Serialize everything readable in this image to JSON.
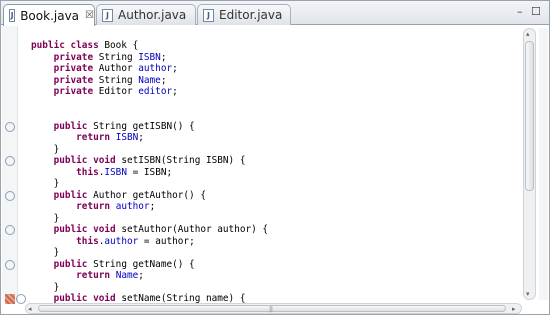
{
  "tabs": [
    {
      "label": "Book.java",
      "icon": "java-file-icon",
      "active": true,
      "close": "☒"
    },
    {
      "label": "Author.java",
      "icon": "java-file-icon",
      "active": false
    },
    {
      "label": "Editor.java",
      "icon": "java-file-icon",
      "active": false
    }
  ],
  "window_controls": {
    "minimize": "–",
    "maximize": "☐"
  },
  "editor": {
    "lines": [
      [
        {
          "t": "public class",
          "c": "kw"
        },
        {
          "t": " Book {"
        }
      ],
      [
        {
          "t": "    "
        },
        {
          "t": "private",
          "c": "kw"
        },
        {
          "t": " String "
        },
        {
          "t": "ISBN",
          "c": "fld"
        },
        {
          "t": ";"
        }
      ],
      [
        {
          "t": "    "
        },
        {
          "t": "private",
          "c": "kw"
        },
        {
          "t": " Author "
        },
        {
          "t": "author",
          "c": "fld"
        },
        {
          "t": ";"
        }
      ],
      [
        {
          "t": "    "
        },
        {
          "t": "private",
          "c": "kw"
        },
        {
          "t": " String "
        },
        {
          "t": "Name",
          "c": "fld"
        },
        {
          "t": ";"
        }
      ],
      [
        {
          "t": "    "
        },
        {
          "t": "private",
          "c": "kw"
        },
        {
          "t": " Editor "
        },
        {
          "t": "editor",
          "c": "fld"
        },
        {
          "t": ";"
        }
      ],
      [],
      [],
      [
        {
          "t": "    "
        },
        {
          "t": "public",
          "c": "kw"
        },
        {
          "t": " String getISBN() {"
        }
      ],
      [
        {
          "t": "        "
        },
        {
          "t": "return",
          "c": "kw"
        },
        {
          "t": " "
        },
        {
          "t": "ISBN",
          "c": "fld"
        },
        {
          "t": ";"
        }
      ],
      [
        {
          "t": "    }"
        }
      ],
      [
        {
          "t": "    "
        },
        {
          "t": "public void",
          "c": "kw"
        },
        {
          "t": " setISBN(String ISBN) {"
        }
      ],
      [
        {
          "t": "        "
        },
        {
          "t": "this",
          "c": "kw"
        },
        {
          "t": "."
        },
        {
          "t": "ISBN",
          "c": "fld"
        },
        {
          "t": " = ISBN;"
        }
      ],
      [
        {
          "t": "    }"
        }
      ],
      [
        {
          "t": "    "
        },
        {
          "t": "public",
          "c": "kw"
        },
        {
          "t": " Author getAuthor() {"
        }
      ],
      [
        {
          "t": "        "
        },
        {
          "t": "return",
          "c": "kw"
        },
        {
          "t": " "
        },
        {
          "t": "author",
          "c": "fld"
        },
        {
          "t": ";"
        }
      ],
      [
        {
          "t": "    }"
        }
      ],
      [
        {
          "t": "    "
        },
        {
          "t": "public void",
          "c": "kw"
        },
        {
          "t": " setAuthor(Author author) {"
        }
      ],
      [
        {
          "t": "        "
        },
        {
          "t": "this",
          "c": "kw"
        },
        {
          "t": "."
        },
        {
          "t": "author",
          "c": "fld"
        },
        {
          "t": " = author;"
        }
      ],
      [
        {
          "t": "    }"
        }
      ],
      [
        {
          "t": "    "
        },
        {
          "t": "public",
          "c": "kw"
        },
        {
          "t": " String getName() {"
        }
      ],
      [
        {
          "t": "        "
        },
        {
          "t": "return",
          "c": "kw"
        },
        {
          "t": " "
        },
        {
          "t": "Name",
          "c": "fld"
        },
        {
          "t": ";"
        }
      ],
      [
        {
          "t": "    }"
        }
      ],
      [
        {
          "t": "    "
        },
        {
          "t": "public void",
          "c": "kw"
        },
        {
          "t": " setName(String name) {"
        }
      ]
    ],
    "fold_markers": [
      7,
      10,
      13,
      16,
      19,
      22
    ],
    "fold_glyph": "⊖",
    "task_marker_line": 22
  },
  "scrollbar": {
    "up": "▴",
    "down": "▾",
    "left": "◂",
    "right": "▸",
    "grip": "|||"
  },
  "colors": {
    "keyword": "#7f0055",
    "field": "#0000c0",
    "text": "#000000"
  }
}
